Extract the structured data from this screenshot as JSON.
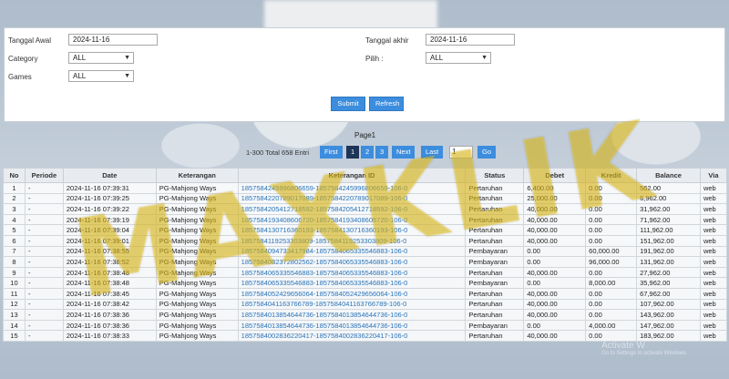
{
  "filters": {
    "start_label": "Tanggal Awal",
    "start_value": "2024-11-16",
    "end_label": "Tanggal akhir",
    "end_value": "2024-11-16",
    "category_label": "Category",
    "category_value": "ALL",
    "pilih_label": "Pilih  :",
    "pilih_value": "ALL",
    "games_label": "Games",
    "games_value": "ALL",
    "submit_label": "Submit",
    "refresh_label": "Refresh"
  },
  "pager": {
    "title": "Page1",
    "total": "1-300 Total 658 Entri",
    "first": "First",
    "pages": [
      "1",
      "2",
      "3"
    ],
    "next": "Next",
    "last": "Last",
    "input_value": "1",
    "go": "Go"
  },
  "table": {
    "headers": [
      "No",
      "Periode",
      "Date",
      "Keterangan",
      "Keterangan ID",
      "Status",
      "Debet",
      "Kredit",
      "Balance",
      "Via"
    ],
    "rows": [
      [
        "1",
        "-",
        "2024-11-16 07:39:31",
        "PG-Mahjong Ways",
        "1857584245996806659-1857584245996806659-106-0",
        "Pertaruhan",
        "6,400.00",
        "0.00",
        "562.00",
        "web"
      ],
      [
        "2",
        "-",
        "2024-11-16 07:39:25",
        "PG-Mahjong Ways",
        "1857584220789017089-1857584220789017089-106-0",
        "Pertaruhan",
        "25,000.00",
        "0.00",
        "6,962.00",
        "web"
      ],
      [
        "3",
        "-",
        "2024-11-16 07:39:22",
        "PG-Mahjong Ways",
        "1857584205412718592-1857584205412718592-106-0",
        "Pertaruhan",
        "40,000.00",
        "0.00",
        "31,962.00",
        "web"
      ],
      [
        "4",
        "-",
        "2024-11-16 07:39:19",
        "PG-Mahjong Ways",
        "1857584193408606720-1857584193408606720-106-0",
        "Pertaruhan",
        "40,000.00",
        "0.00",
        "71,962.00",
        "web"
      ],
      [
        "5",
        "-",
        "2024-11-16 07:39:04",
        "PG-Mahjong Ways",
        "1857584130716360193-1857584130716360193-106-0",
        "Pertaruhan",
        "40,000.00",
        "0.00",
        "111,962.00",
        "web"
      ],
      [
        "6",
        "-",
        "2024-11-16 07:39:01",
        "PG-Mahjong Ways",
        "1857584119253303809-1857584119253303809-106-0",
        "Pertaruhan",
        "40,000.00",
        "0.00",
        "151,962.00",
        "web"
      ],
      [
        "7",
        "-",
        "2024-11-16 07:38:55",
        "PG-Mahjong Ways",
        "1857584094733417984-1857584065335546883-106-0",
        "Pembayaran",
        "0.00",
        "60,000.00",
        "191,962.00",
        "web"
      ],
      [
        "8",
        "-",
        "2024-11-16 07:38:52",
        "PG-Mahjong Ways",
        "1857584082372802562-1857584065335546883-106-0",
        "Pembayaran",
        "0.00",
        "96,000.00",
        "131,962.00",
        "web"
      ],
      [
        "9",
        "-",
        "2024-11-16 07:38:48",
        "PG-Mahjong Ways",
        "1857584065335546883-1857584065335546883-106-0",
        "Pertaruhan",
        "40,000.00",
        "0.00",
        "27,962.00",
        "web"
      ],
      [
        "10",
        "-",
        "2024-11-16 07:38:48",
        "PG-Mahjong Ways",
        "1857584065335546883-1857584065335546883-106-0",
        "Pembayaran",
        "0.00",
        "8,000.00",
        "35,962.00",
        "web"
      ],
      [
        "11",
        "-",
        "2024-11-16 07:38:45",
        "PG-Mahjong Ways",
        "1857584052429656064-1857584052429656064-106-0",
        "Pertaruhan",
        "40,000.00",
        "0.00",
        "67,962.00",
        "web"
      ],
      [
        "12",
        "-",
        "2024-11-16 07:38:42",
        "PG-Mahjong Ways",
        "1857584041163766789-1857584041163766789-106-0",
        "Pertaruhan",
        "40,000.00",
        "0.00",
        "107,962.00",
        "web"
      ],
      [
        "13",
        "-",
        "2024-11-16 07:38:36",
        "PG-Mahjong Ways",
        "1857584013854644736-1857584013854644736-106-0",
        "Pertaruhan",
        "40,000.00",
        "0.00",
        "143,962.00",
        "web"
      ],
      [
        "14",
        "-",
        "2024-11-16 07:38:36",
        "PG-Mahjong Ways",
        "1857584013854644736-1857584013854644736-106-0",
        "Pembayaran",
        "0.00",
        "4,000.00",
        "147,962.00",
        "web"
      ],
      [
        "15",
        "-",
        "2024-11-16 07:38:33",
        "PG-Mahjong Ways",
        "1857584002836220417-1857584002836220417-106-0",
        "Pertaruhan",
        "40,000.00",
        "0.00",
        "183,962.00",
        "web"
      ]
    ]
  },
  "watermark": "MAXKLIK",
  "activate": {
    "title": "Activate W",
    "sub": "Go to Settings to activate Windows"
  }
}
